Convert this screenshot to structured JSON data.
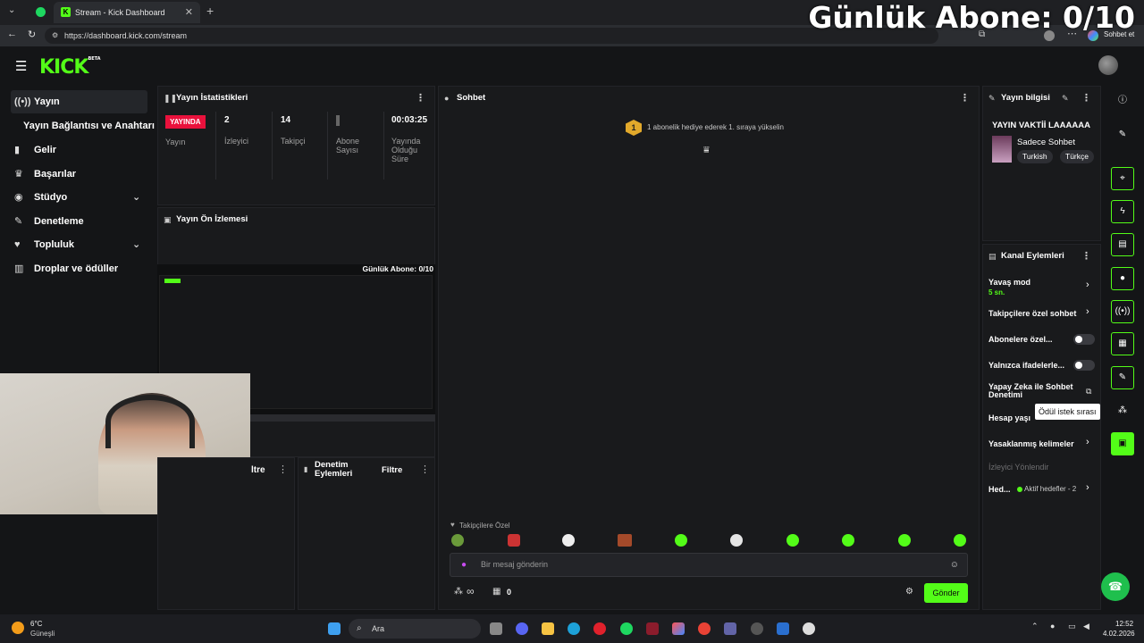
{
  "browser": {
    "tab_title": "Stream - Kick Dashboard",
    "url": "https://dashboard.kick.com/stream",
    "chat_button": "Sohbet et"
  },
  "overlay": {
    "title": "Günlük Abone: 0/10"
  },
  "app": {
    "logo": "KICK",
    "logo_badge": "BETA"
  },
  "sidebar": {
    "items": [
      {
        "label": "Yayın",
        "icon": "broadcast-icon"
      },
      {
        "label": "Yayın Bağlantısı ve Anahtarı"
      },
      {
        "label": "Gelir",
        "icon": "chart-icon"
      },
      {
        "label": "Başarılar",
        "icon": "trophy-icon"
      },
      {
        "label": "Stüdyo",
        "icon": "studio-icon"
      },
      {
        "label": "Denetleme",
        "icon": "wrench-icon"
      },
      {
        "label": "Topluluk",
        "icon": "community-icon"
      },
      {
        "label": "Droplar ve ödüller",
        "icon": "drops-icon"
      }
    ]
  },
  "stats": {
    "title": "Yayın İstatistikleri",
    "live_badge": "YAYINDA",
    "items": [
      {
        "value": "",
        "label": "Yayın"
      },
      {
        "value": "2",
        "label": "İzleyici"
      },
      {
        "value": "14",
        "label": "Takipçi"
      },
      {
        "value": "",
        "label": "Abone Sayısı"
      },
      {
        "value": "00:03:25",
        "label": "Yayında Olduğu Süre"
      }
    ]
  },
  "preview": {
    "title": "Yayın Ön İzlemesi",
    "mini_overlay": "Günlük Abone: 0/10"
  },
  "bottom_panels": {
    "left_title_fragment": "ltre",
    "mod_actions_title": "Denetim Eylemleri",
    "filter_label": "Filtre"
  },
  "chat": {
    "title": "Sohbet",
    "notice_badge": "1",
    "notice": "1 abonelik hediye ederek 1. sıraya yükselin",
    "followers_only_label": "Takipçilere Özel",
    "input_placeholder": "Bir mesaj gönderin",
    "infinity_label": "∞",
    "gift_count": "0",
    "send_label": "Gönder"
  },
  "stream_info": {
    "title": "Yayın bilgisi",
    "stream_title": "YAYIN VAKTİİ LAAAAAA",
    "category": "Sadece Sohbet",
    "tags": [
      "Turkish",
      "Türkçe"
    ]
  },
  "channel_actions": {
    "title": "Kanal Eylemleri",
    "slow_mode": "Yavaş mod",
    "slow_mode_value": "5 sn.",
    "followers_chat": "Takipçilere özel sohbet",
    "subscribers_only": "Abonelere özel...",
    "emotes_only": "Yalnızca ifadelerle...",
    "ai_moderation": "Yapay Zeka ile Sohbet Denetimi",
    "account_age": "Hesap yaşı",
    "banned_words": "Yasaklanmış kelimeler",
    "redirect_viewers": "İzleyici Yönlendir",
    "goals_label": "Hed...",
    "goals_status": "Aktif hedefler - 2",
    "tooltip": "Ödül istek sırası"
  },
  "taskbar": {
    "weather_temp": "6°C",
    "weather_desc": "Güneşli",
    "search_label": "Ara",
    "time": "12:52",
    "date": "4.02.2026"
  },
  "colors": {
    "accent": "#53fc18",
    "live": "#e9113c",
    "background": "#141517"
  }
}
